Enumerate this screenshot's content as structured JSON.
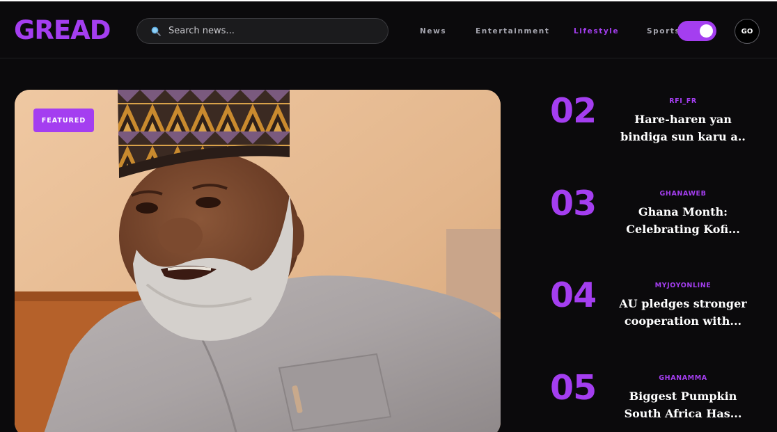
{
  "brand": {
    "logo": "GREAD",
    "accent": "#a43ef0"
  },
  "search": {
    "placeholder": "Search news...",
    "value": ""
  },
  "nav": [
    {
      "label": "News",
      "active": false
    },
    {
      "label": "Entertainment",
      "active": false
    },
    {
      "label": "Lifestyle",
      "active": true
    },
    {
      "label": "Sports",
      "active": false
    }
  ],
  "theme_toggle": {
    "on": true
  },
  "go_button": {
    "label": "GO"
  },
  "featured": {
    "badge": "FEATURED",
    "image": "portrait of a smiling man with white beard wearing embroidered cap and grey kaftan"
  },
  "trending": [
    {
      "number": "02",
      "source": "RFI_FR",
      "title_line1": "Hare-haren yan",
      "title_line2": "bindiga sun karu a.."
    },
    {
      "number": "03",
      "source": "GHANAWEB",
      "title_line1": "Ghana Month:",
      "title_line2": "Celebrating Kofi..."
    },
    {
      "number": "04",
      "source": "MYJOYONLINE",
      "title_line1": "AU pledges stronger",
      "title_line2": "cooperation with..."
    },
    {
      "number": "05",
      "source": "GHANAMMA",
      "title_line1": "Biggest Pumpkin",
      "title_line2": "South Africa Has..."
    }
  ]
}
